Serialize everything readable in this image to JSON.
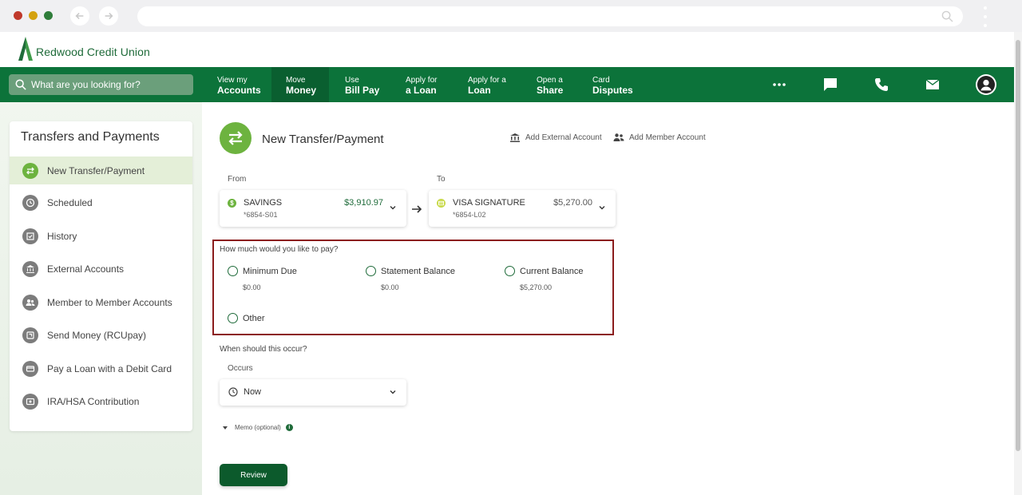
{
  "brand": {
    "name": "Redwood Credit Union",
    "color": "#0c733a",
    "accent": "#6db33f"
  },
  "search": {
    "placeholder": "What are you looking for?"
  },
  "nav": {
    "items": [
      {
        "small": "View my",
        "big": "Accounts"
      },
      {
        "small": "Move",
        "big": "Money",
        "active": true
      },
      {
        "small": "Use",
        "big": "Bill Pay"
      },
      {
        "small": "Apply for",
        "big": "a Loan"
      },
      {
        "small": "Apply for a",
        "big": "Loan"
      },
      {
        "small": "Open a",
        "big": "Share"
      },
      {
        "small": "Card",
        "big": "Disputes"
      }
    ],
    "icons": [
      "more-icon",
      "chat-icon",
      "phone-icon",
      "mail-icon",
      "profile-icon"
    ]
  },
  "sidebar": {
    "title": "Transfers and Payments",
    "items": [
      {
        "label": "New Transfer/Payment",
        "icon": "transfer-icon",
        "active": true
      },
      {
        "label": "Scheduled",
        "icon": "clock-icon"
      },
      {
        "label": "History",
        "icon": "history-icon"
      },
      {
        "label": "External Accounts",
        "icon": "bank-icon"
      },
      {
        "label": "Member to Member Accounts",
        "icon": "members-icon"
      },
      {
        "label": "Send Money (RCUpay)",
        "icon": "send-money-icon"
      },
      {
        "label": "Pay a Loan with a Debit Card",
        "icon": "card-icon"
      },
      {
        "label": "IRA/HSA Contribution",
        "icon": "ira-icon"
      }
    ]
  },
  "main": {
    "title": "New Transfer/Payment",
    "add_external": "Add External Account",
    "add_member": "Add Member Account",
    "from_label": "From",
    "to_label": "To",
    "from": {
      "name": "SAVINGS",
      "number": "*6854-S01",
      "balance": "$3,910.97"
    },
    "to": {
      "name": "VISA SIGNATURE",
      "number": "*6854-L02",
      "balance": "$5,270.00"
    },
    "pay_question": "How much would you like to pay?",
    "options": [
      {
        "label": "Minimum Due",
        "amount": "$0.00"
      },
      {
        "label": "Statement Balance",
        "amount": "$0.00"
      },
      {
        "label": "Current Balance",
        "amount": "$5,270.00"
      },
      {
        "label": "Other",
        "amount": ""
      }
    ],
    "when_question": "When should this occur?",
    "occurs_label": "Occurs",
    "occurs_value": "Now",
    "memo_label": "Memo (optional)",
    "review_label": "Review"
  }
}
